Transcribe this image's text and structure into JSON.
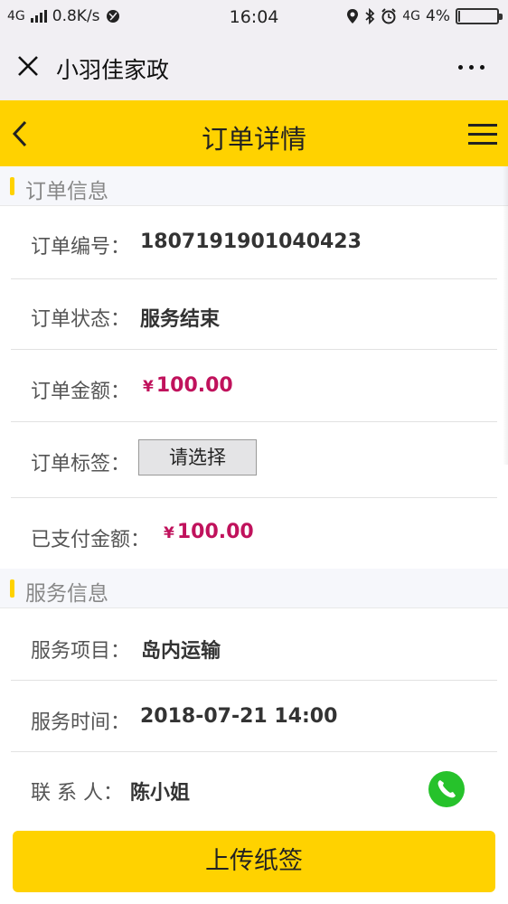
{
  "status_bar": {
    "network": "4G",
    "speed": "0.8K/s",
    "time": "16:04",
    "network2": "4G",
    "battery_text": "4%",
    "battery_level": 0.04
  },
  "wechat_bar": {
    "title": "小羽佳家政"
  },
  "header": {
    "title": "订单详情"
  },
  "order_section": {
    "title": "订单信息",
    "rows": [
      {
        "label": "订单编号：",
        "value": "1807191901040423"
      },
      {
        "label": "订单状态：",
        "value": "服务结束"
      },
      {
        "label": "订单金额：",
        "currency": "¥",
        "value": "100.00"
      },
      {
        "label": "订单标签：",
        "select_value": "请选择"
      },
      {
        "label": "已支付金额：",
        "currency": "¥",
        "value": "100.00"
      }
    ]
  },
  "service_section": {
    "title": "服务信息",
    "rows": [
      {
        "label": "服务项目：",
        "value": "岛内运输"
      },
      {
        "label": "服务时间：",
        "value": "2018-07-21 14:00"
      },
      {
        "label": "联 系 人：",
        "value": "陈小姐"
      }
    ]
  },
  "footer": {
    "button_label": "上传纸签"
  },
  "colors": {
    "accent": "#ffd200",
    "money": "#c0125c",
    "phone": "#26c22b"
  }
}
